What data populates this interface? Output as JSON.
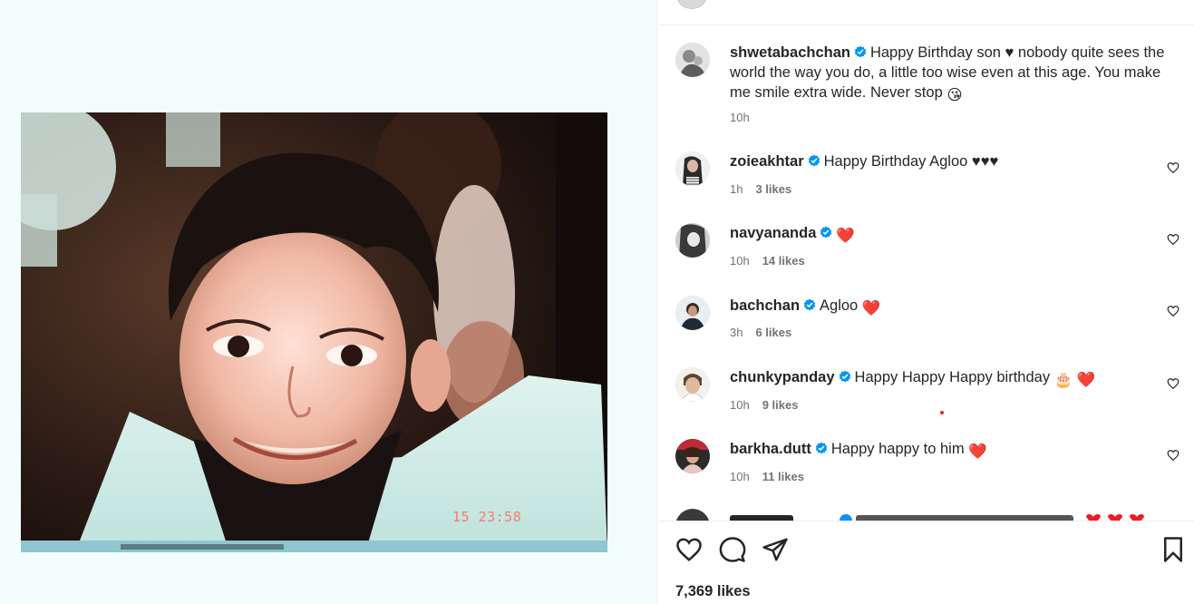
{
  "post": {
    "photo_timestamp": "15 23:58",
    "caption": {
      "username": "shwetabachchan",
      "text": "Happy Birthday son ♥ nobody quite sees the world the way you do, a little too wise even at this age. You make me smile extra wide. Never stop",
      "emoji": "😘",
      "time": "10h"
    },
    "likes_label": "7,369 likes"
  },
  "comments": [
    {
      "username": "zoieakhtar",
      "text": "Happy Birthday Agloo ♥♥♥",
      "emoji": "",
      "time": "1h",
      "likes": "3 likes"
    },
    {
      "username": "navyananda",
      "text": "",
      "emoji": "❤️",
      "time": "10h",
      "likes": "14 likes"
    },
    {
      "username": "bachchan",
      "text": "Agloo",
      "emoji": "❤️",
      "time": "3h",
      "likes": "6 likes"
    },
    {
      "username": "chunkypanday",
      "text": "Happy Happy Happy birthday",
      "emoji": "🎂 ❤️",
      "time": "10h",
      "likes": "9 likes"
    },
    {
      "username": "barkha.dutt",
      "text": "Happy happy to him",
      "emoji": "❤️",
      "time": "10h",
      "likes": "11 likes"
    }
  ],
  "icons": {
    "like": "heart-outline-icon",
    "comment": "comment-bubble-icon",
    "share": "paper-plane-icon",
    "save": "bookmark-icon",
    "verified": "verified-badge-icon"
  },
  "colors": {
    "verified_blue": "#0095f6",
    "heart_red": "#ed1c24",
    "secondary_text": "#737373"
  }
}
